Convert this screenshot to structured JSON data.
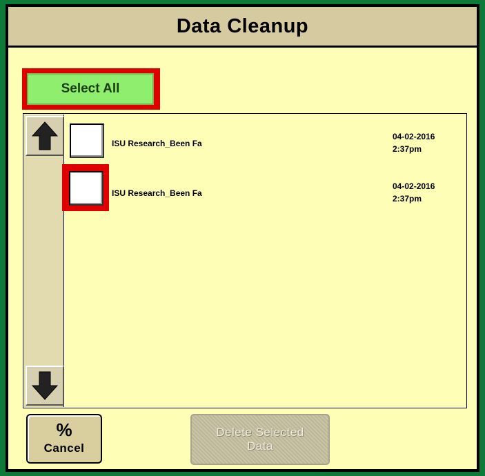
{
  "dialog": {
    "title": "Data Cleanup",
    "select_all_label": "Select All",
    "items": [
      {
        "name": "ISU Research_Been Fa",
        "date": "04-02-2016",
        "time": "2:37pm",
        "checked": false
      },
      {
        "name": "ISU Research_Been Fa",
        "date": "04-02-2016",
        "time": "2:37pm",
        "checked": false
      }
    ],
    "cancel_icon": "%",
    "cancel_label": "Cancel",
    "delete_label_line1": "Delete Selected",
    "delete_label_line2": "Data"
  },
  "icons": {
    "scroll_up": "up-arrow-icon",
    "scroll_down": "down-arrow-icon",
    "cancel": "cancel-percent-icon"
  },
  "colors": {
    "background": "#fefeb6",
    "titlebar": "#d6caa0",
    "select_all": "#8fee6e",
    "highlight": "#e00000",
    "outer_border": "#0e7a3a"
  }
}
